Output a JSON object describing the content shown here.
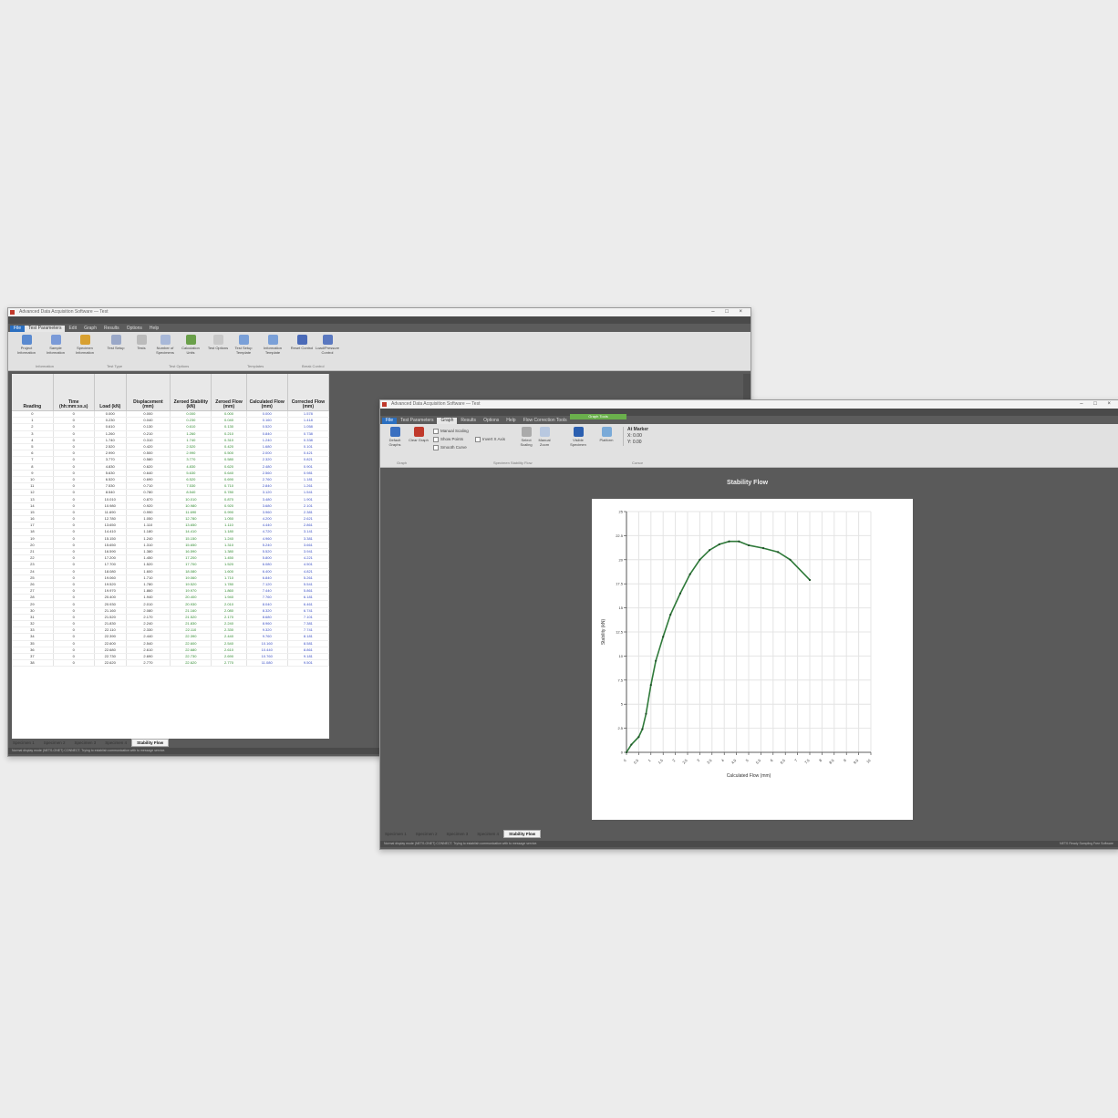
{
  "colors": {
    "accent": "#2b6fc0",
    "curve": "#2f7a3a",
    "grid": "#e4e4e4",
    "green_text": "#2f8a2f",
    "blue_text": "#3a4fc4"
  },
  "back_window": {
    "title": "Advanced Data Acquisition Software — Test",
    "menu": [
      "File",
      "Test Parameters",
      "Edit",
      "Graph",
      "Results",
      "Options",
      "Help"
    ],
    "ribbon_buttons": [
      {
        "label": "Project Information",
        "icon": "project-info-icon",
        "color": "#5a8ad0"
      },
      {
        "label": "Sample Information",
        "icon": "sample-info-icon",
        "color": "#7a9ad8"
      },
      {
        "label": "Specimen Information",
        "icon": "specimen-info-icon",
        "color": "#d8a030"
      },
      {
        "label": "Test Setup",
        "icon": "test-setup-icon",
        "color": "#9aa8c8"
      },
      {
        "label": "Tests",
        "icon": "tests-icon",
        "color": "#bbbbbb"
      },
      {
        "label": "Number of Specimens",
        "icon": "specimens-icon",
        "color": "#a8b8d8"
      },
      {
        "label": "Calculation Units",
        "icon": "calc-units-icon",
        "color": "#6aa04a"
      },
      {
        "label": "Test Options",
        "icon": "test-options-icon",
        "color": "#c8c8c8"
      },
      {
        "label": "Test Setup Template",
        "icon": "template-icon",
        "color": "#7aa0d8"
      },
      {
        "label": "Information Template",
        "icon": "info-template-icon",
        "color": "#7aa0d8"
      },
      {
        "label": "Reset Control",
        "icon": "reset-control-icon",
        "color": "#4a6ab8"
      },
      {
        "label": "Load/Pressure Control",
        "icon": "load-control-icon",
        "color": "#5a78c0"
      }
    ],
    "ribbon_groups": [
      "Information",
      "Test Type",
      "Test Options",
      "Templates",
      "Break Control"
    ],
    "columns": [
      "Reading",
      "Time (hh:mm:ss.s)",
      "Load (kN)",
      "Displacement (mm)",
      "Zeroed Stability (kN)",
      "Zeroed Flow (mm)",
      "Calculated Flow (mm)",
      "Corrected Flow (mm)"
    ],
    "rows": [
      [
        "0",
        "0",
        "0.000",
        "0.000",
        "0.000",
        "0.000",
        "0.000",
        "1.578"
      ],
      [
        "1",
        "0",
        "0.230",
        "0.040",
        "0.230",
        "0.040",
        "0.160",
        "1.418"
      ],
      [
        "2",
        "0",
        "0.610",
        "0.130",
        "0.610",
        "0.130",
        "0.520",
        "1.058"
      ],
      [
        "3",
        "0",
        "1.260",
        "0.210",
        "1.260",
        "0.210",
        "0.840",
        "0.738"
      ],
      [
        "4",
        "0",
        "1.740",
        "0.310",
        "1.740",
        "0.310",
        "1.240",
        "0.338"
      ],
      [
        "5",
        "0",
        "2.520",
        "0.420",
        "2.520",
        "0.420",
        "1.680",
        "0.101"
      ],
      [
        "6",
        "0",
        "2.990",
        "0.500",
        "2.990",
        "0.500",
        "2.000",
        "0.421"
      ],
      [
        "7",
        "0",
        "3.770",
        "0.580",
        "3.770",
        "0.580",
        "2.320",
        "0.821"
      ],
      [
        "8",
        "0",
        "4.830",
        "0.620",
        "4.830",
        "0.620",
        "2.480",
        "0.901"
      ],
      [
        "9",
        "0",
        "5.630",
        "0.640",
        "5.630",
        "0.640",
        "2.560",
        "0.981"
      ],
      [
        "10",
        "0",
        "6.520",
        "0.690",
        "6.520",
        "0.690",
        "2.760",
        "1.181"
      ],
      [
        "11",
        "0",
        "7.530",
        "0.710",
        "7.530",
        "0.710",
        "2.840",
        "1.261"
      ],
      [
        "12",
        "0",
        "8.540",
        "0.780",
        "8.540",
        "0.780",
        "3.120",
        "1.541"
      ],
      [
        "13",
        "0",
        "10.010",
        "0.870",
        "10.010",
        "0.870",
        "3.480",
        "1.901"
      ],
      [
        "14",
        "0",
        "10.980",
        "0.920",
        "10.980",
        "0.920",
        "3.680",
        "2.101"
      ],
      [
        "15",
        "0",
        "11.690",
        "0.990",
        "11.690",
        "0.990",
        "3.960",
        "2.381"
      ],
      [
        "16",
        "0",
        "12.780",
        "1.050",
        "12.780",
        "1.050",
        "4.200",
        "2.621"
      ],
      [
        "17",
        "0",
        "13.650",
        "1.110",
        "13.650",
        "1.110",
        "4.440",
        "2.861"
      ],
      [
        "18",
        "0",
        "14.410",
        "1.180",
        "14.410",
        "1.180",
        "4.720",
        "3.141"
      ],
      [
        "19",
        "0",
        "15.150",
        "1.240",
        "15.150",
        "1.240",
        "4.960",
        "3.381"
      ],
      [
        "20",
        "0",
        "15.650",
        "1.310",
        "15.650",
        "1.310",
        "5.240",
        "3.661"
      ],
      [
        "21",
        "0",
        "16.590",
        "1.380",
        "16.590",
        "1.380",
        "5.520",
        "3.941"
      ],
      [
        "22",
        "0",
        "17.200",
        "1.450",
        "17.200",
        "1.450",
        "5.800",
        "4.221"
      ],
      [
        "23",
        "0",
        "17.700",
        "1.520",
        "17.700",
        "1.520",
        "6.080",
        "4.501"
      ],
      [
        "24",
        "0",
        "18.080",
        "1.600",
        "18.080",
        "1.600",
        "6.400",
        "4.821"
      ],
      [
        "25",
        "0",
        "19.060",
        "1.710",
        "19.060",
        "1.710",
        "6.840",
        "5.261"
      ],
      [
        "26",
        "0",
        "19.520",
        "1.780",
        "19.520",
        "1.780",
        "7.120",
        "5.541"
      ],
      [
        "27",
        "0",
        "19.970",
        "1.860",
        "19.970",
        "1.860",
        "7.440",
        "5.861"
      ],
      [
        "28",
        "0",
        "20.400",
        "1.940",
        "20.400",
        "1.940",
        "7.760",
        "6.181"
      ],
      [
        "29",
        "0",
        "20.930",
        "2.010",
        "20.930",
        "2.010",
        "8.040",
        "6.461"
      ],
      [
        "30",
        "0",
        "21.160",
        "2.080",
        "21.160",
        "2.080",
        "8.320",
        "6.741"
      ],
      [
        "31",
        "0",
        "21.520",
        "2.170",
        "21.520",
        "2.170",
        "8.680",
        "7.101"
      ],
      [
        "32",
        "0",
        "21.830",
        "2.240",
        "21.830",
        "2.240",
        "8.960",
        "7.381"
      ],
      [
        "33",
        "0",
        "22.110",
        "2.330",
        "22.110",
        "2.330",
        "9.320",
        "7.741"
      ],
      [
        "34",
        "0",
        "22.390",
        "2.440",
        "22.390",
        "2.440",
        "9.760",
        "8.181"
      ],
      [
        "35",
        "0",
        "22.600",
        "2.540",
        "22.600",
        "2.540",
        "10.160",
        "8.581"
      ],
      [
        "36",
        "0",
        "22.680",
        "2.610",
        "22.680",
        "2.610",
        "10.440",
        "8.861"
      ],
      [
        "37",
        "0",
        "22.730",
        "2.690",
        "22.730",
        "2.690",
        "10.760",
        "9.181"
      ],
      [
        "38",
        "0",
        "22.620",
        "2.770",
        "22.620",
        "2.770",
        "11.080",
        "9.501"
      ]
    ],
    "bottom_tabs": [
      "Specimen 1",
      "Specimen 2",
      "Specimen 3",
      "Specimen 4",
      "Stability Flow"
    ],
    "status": "Normal display mode (NETS-ONET) CONNECT. Trying to establish communication with to message service."
  },
  "front_window": {
    "title": "Advanced Data Acquisition Software — Test",
    "menu": [
      "File",
      "Test Parameters",
      "Graph",
      "Results",
      "Options",
      "Help",
      "Flow Correction Tools"
    ],
    "contextual_tab": "Graph Tools",
    "ribbon_buttons": [
      {
        "label": "Default Graphs",
        "icon": "default-graphs-icon",
        "color": "#3a6fc0"
      },
      {
        "label": "Clear Graph",
        "icon": "clear-graph-icon",
        "color": "#c0392b"
      },
      {
        "label": "Select Scaling",
        "icon": "select-scaling-icon",
        "color": "#aaaaaa"
      },
      {
        "label": "Manual Zoom",
        "icon": "manual-zoom-icon",
        "color": "#b8c8e0"
      },
      {
        "label": "Visible Specimen",
        "icon": "visible-specimen-icon",
        "color": "#2b5fb0"
      },
      {
        "label": "Platform",
        "icon": "platform-icon",
        "color": "#7aaad8"
      }
    ],
    "checkboxes": [
      "Manual Scaling",
      "Show Points",
      "Smooth Curve"
    ],
    "secondary_checkbox": "Invert X Axis",
    "cursor_panel": {
      "title": "At Marker",
      "x": "X: 0.00",
      "y": "Y: 0.00"
    },
    "ribbon_groups": [
      "Graph",
      "Specimen Stability Flow",
      "Cursor"
    ],
    "graph_title": "Stability Flow",
    "bottom_tabs": [
      "Specimen 1",
      "Specimen 2",
      "Specimen 3",
      "Specimen 4",
      "Stability Flow"
    ],
    "status": "Normal display mode (NETS-ONET) CONNECT. Trying to establish communication with to message service.",
    "status_right": "NETS Ready    Sampling    Free Software"
  },
  "chart_data": {
    "type": "line",
    "title": "Stability Flow",
    "xlabel": "Calculated Flow (mm)",
    "ylabel": "Stability (kN)",
    "xlim": [
      0,
      10
    ],
    "ylim": [
      0,
      25
    ],
    "xticks": [
      "0",
      "0.5",
      "1",
      "1.5",
      "2",
      "2.5",
      "3",
      "3.5",
      "4",
      "4.5",
      "5",
      "5.5",
      "6",
      "6.5",
      "7",
      "7.5",
      "8",
      "8.5",
      "9",
      "9.5",
      "10"
    ],
    "yticks": [
      "0",
      "2.5",
      "5",
      "7.5",
      "10",
      "12.5",
      "15",
      "17.5",
      "20",
      "22.5",
      "25"
    ],
    "grid": true,
    "series": [
      {
        "x": [
          0,
          0.2,
          0.5,
          0.65,
          0.8,
          1.0,
          1.2,
          1.5,
          1.8,
          2.2,
          2.6,
          3.0,
          3.4,
          3.8,
          4.2,
          4.6,
          5.0,
          5.6,
          6.2,
          6.7,
          7.5
        ],
        "y": [
          0,
          0.8,
          1.6,
          2.4,
          4.0,
          7.0,
          9.5,
          12.0,
          14.3,
          16.5,
          18.5,
          20.0,
          21.0,
          21.6,
          21.9,
          21.9,
          21.5,
          21.2,
          20.8,
          20.0,
          17.9
        ]
      }
    ]
  }
}
